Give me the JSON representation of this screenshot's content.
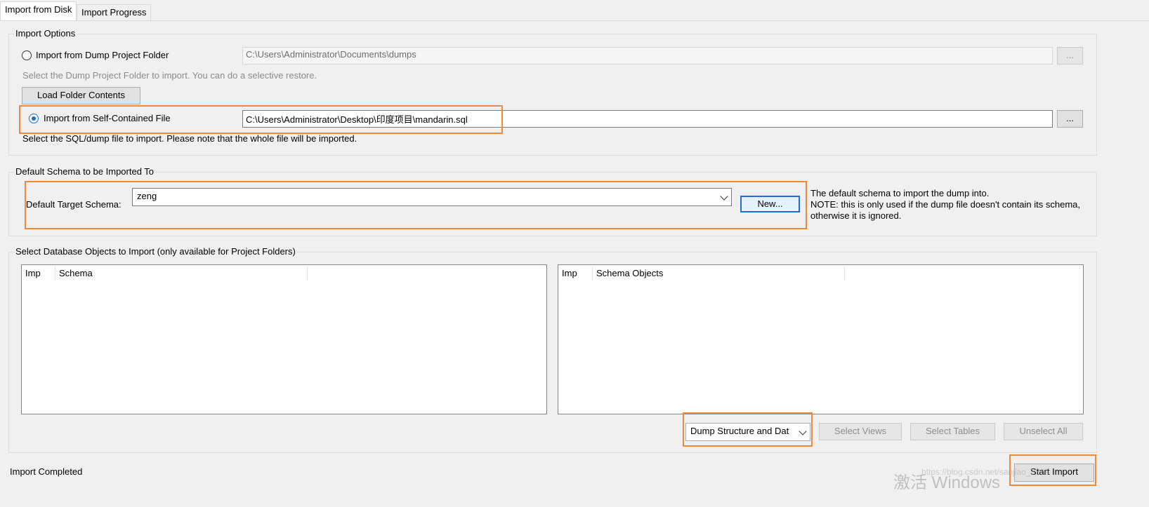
{
  "tabs": [
    {
      "label": "Import from Disk"
    },
    {
      "label": "Import Progress"
    }
  ],
  "import_options": {
    "legend": "Import Options",
    "dump_folder_label": "Import from Dump Project Folder",
    "dump_folder_path": "C:\\Users\\Administrator\\Documents\\dumps",
    "dump_folder_hint": "Select the Dump Project Folder to import. You can do a selective restore.",
    "load_folder_button": "Load Folder Contents",
    "self_contained_label": "Import from Self-Contained File",
    "self_contained_path": "C:\\Users\\Administrator\\Desktop\\印度项目\\mandarin.sql",
    "self_contained_hint": "Select the SQL/dump file to import. Please note that the whole file will be imported.",
    "browse_label": "..."
  },
  "default_schema": {
    "legend": "Default Schema to be Imported To",
    "target_label": "Default Target Schema:",
    "selected_value": "zeng",
    "new_button": "New...",
    "note_line1": "The default schema to import the dump into.",
    "note_line2": "NOTE: this is only used if the dump file doesn't contain its schema,",
    "note_line3": "otherwise it is ignored."
  },
  "db_objects": {
    "legend": "Select Database Objects to Import (only available for Project Folders)",
    "left_columns": [
      "Imp",
      "Schema"
    ],
    "right_columns": [
      "Imp",
      "Schema Objects"
    ],
    "dump_select_value": "Dump Structure and Dat",
    "select_views": "Select Views",
    "select_tables": "Select Tables",
    "unselect_all": "Unselect All"
  },
  "footer": {
    "status": "Import Completed",
    "start_import": "Start Import",
    "watermark_activate": "激活 Windows",
    "watermark_url": "https://blog.csdn.net/sanjiao_3369"
  },
  "colors": {
    "highlight": "#ef8a3b",
    "focus_blue": "#1f6ed4",
    "radio_blue": "#1a6fd1"
  }
}
